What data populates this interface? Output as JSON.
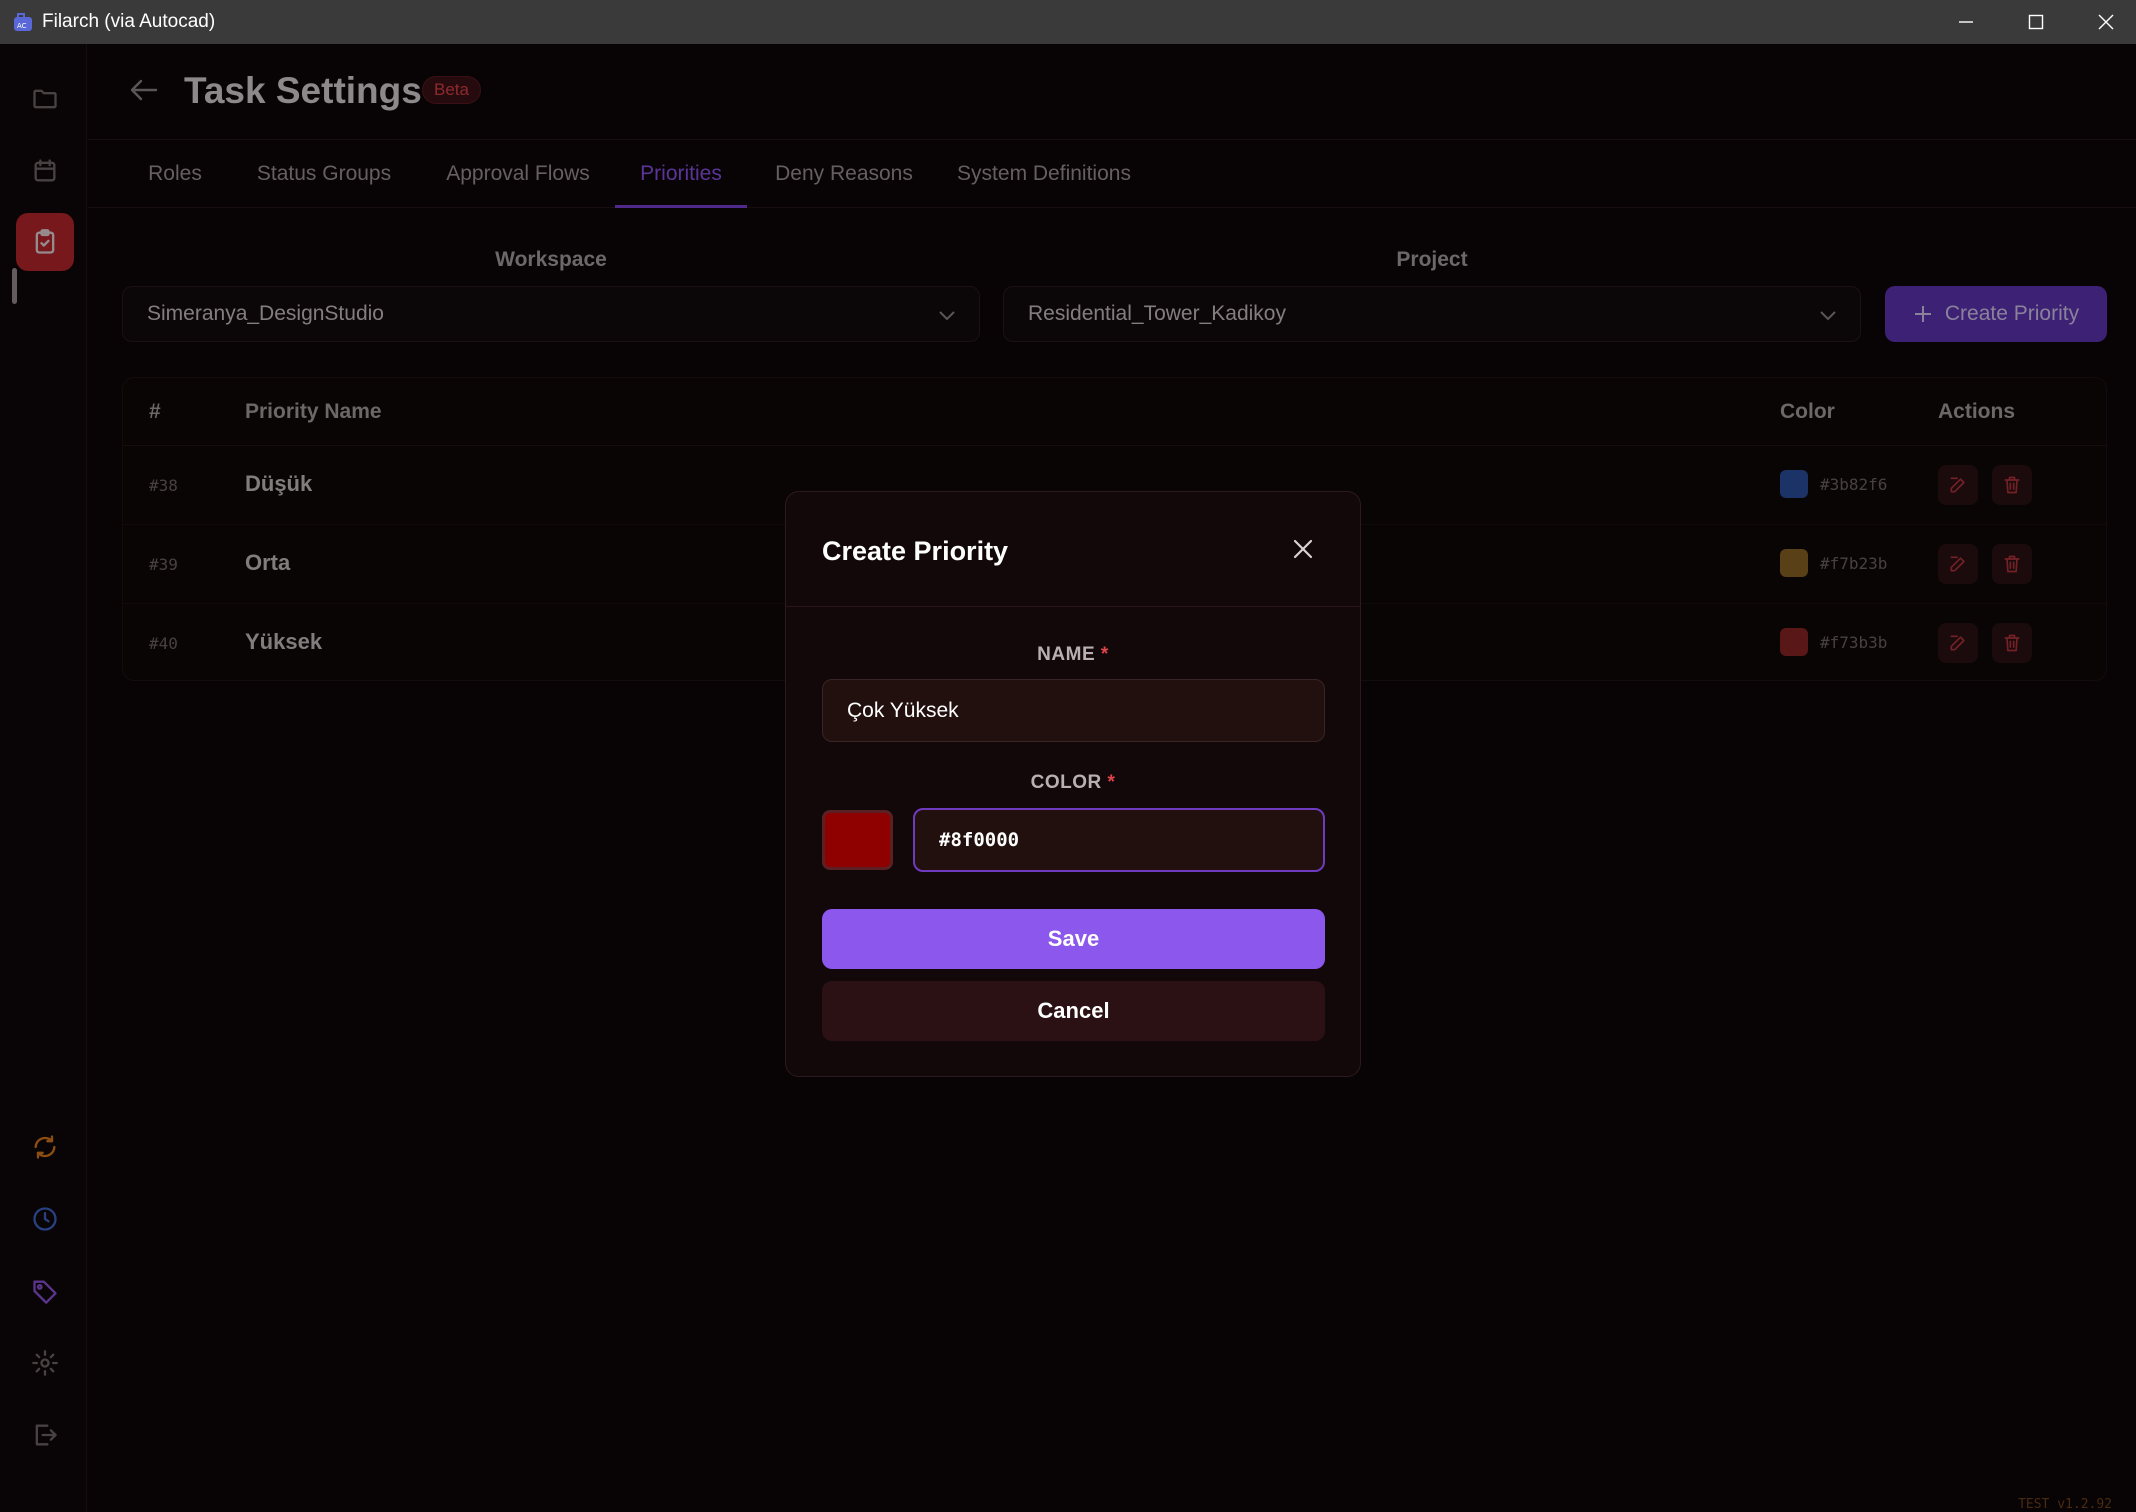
{
  "window": {
    "title": "Filarch (via Autocad)"
  },
  "sidebar": {
    "items": [
      {
        "icon": "folder-icon",
        "color": "#6f6668"
      },
      {
        "icon": "calendar-icon",
        "color": "#6f6668"
      },
      {
        "icon": "clipboard-check-icon",
        "color": "#e8d7d9",
        "active": true
      },
      {
        "icon": "sync-icon",
        "color": "#d9771e"
      },
      {
        "icon": "clock-icon",
        "color": "#3f63c9"
      },
      {
        "icon": "tag-icon",
        "color": "#8d52d8"
      },
      {
        "icon": "gear-icon",
        "color": "#6f6668"
      },
      {
        "icon": "logout-icon",
        "color": "#6f6668"
      }
    ]
  },
  "header": {
    "title": "Task Settings",
    "badge": "Beta"
  },
  "tabs": [
    {
      "label": "Roles"
    },
    {
      "label": "Status Groups"
    },
    {
      "label": "Approval Flows"
    },
    {
      "label": "Priorities",
      "active": true
    },
    {
      "label": "Deny Reasons"
    },
    {
      "label": "System Definitions"
    }
  ],
  "filters": {
    "workspace_label": "Workspace",
    "workspace_value": "Simeranya_DesignStudio",
    "project_label": "Project",
    "project_value": "Residential_Tower_Kadikoy",
    "create_button": "Create Priority"
  },
  "table": {
    "headers": {
      "id": "#",
      "name": "Priority Name",
      "color": "Color",
      "actions": "Actions"
    },
    "rows": [
      {
        "id": "#38",
        "name": "Düşük",
        "color": "#3b82f6",
        "swatch": "#2c4f9e"
      },
      {
        "id": "#39",
        "name": "Orta",
        "color": "#f7b23b",
        "swatch": "#8a6322"
      },
      {
        "id": "#40",
        "name": "Yüksek",
        "color": "#f73b3b",
        "swatch": "#8a2424"
      }
    ]
  },
  "modal": {
    "title": "Create Priority",
    "name_label": "NAME",
    "name_value": "Çok Yüksek",
    "color_label": "COLOR",
    "required_mark": "*",
    "color_value": "#8f0000",
    "save": "Save",
    "cancel": "Cancel"
  },
  "footer": {
    "version": "TEST v1.2.92"
  }
}
